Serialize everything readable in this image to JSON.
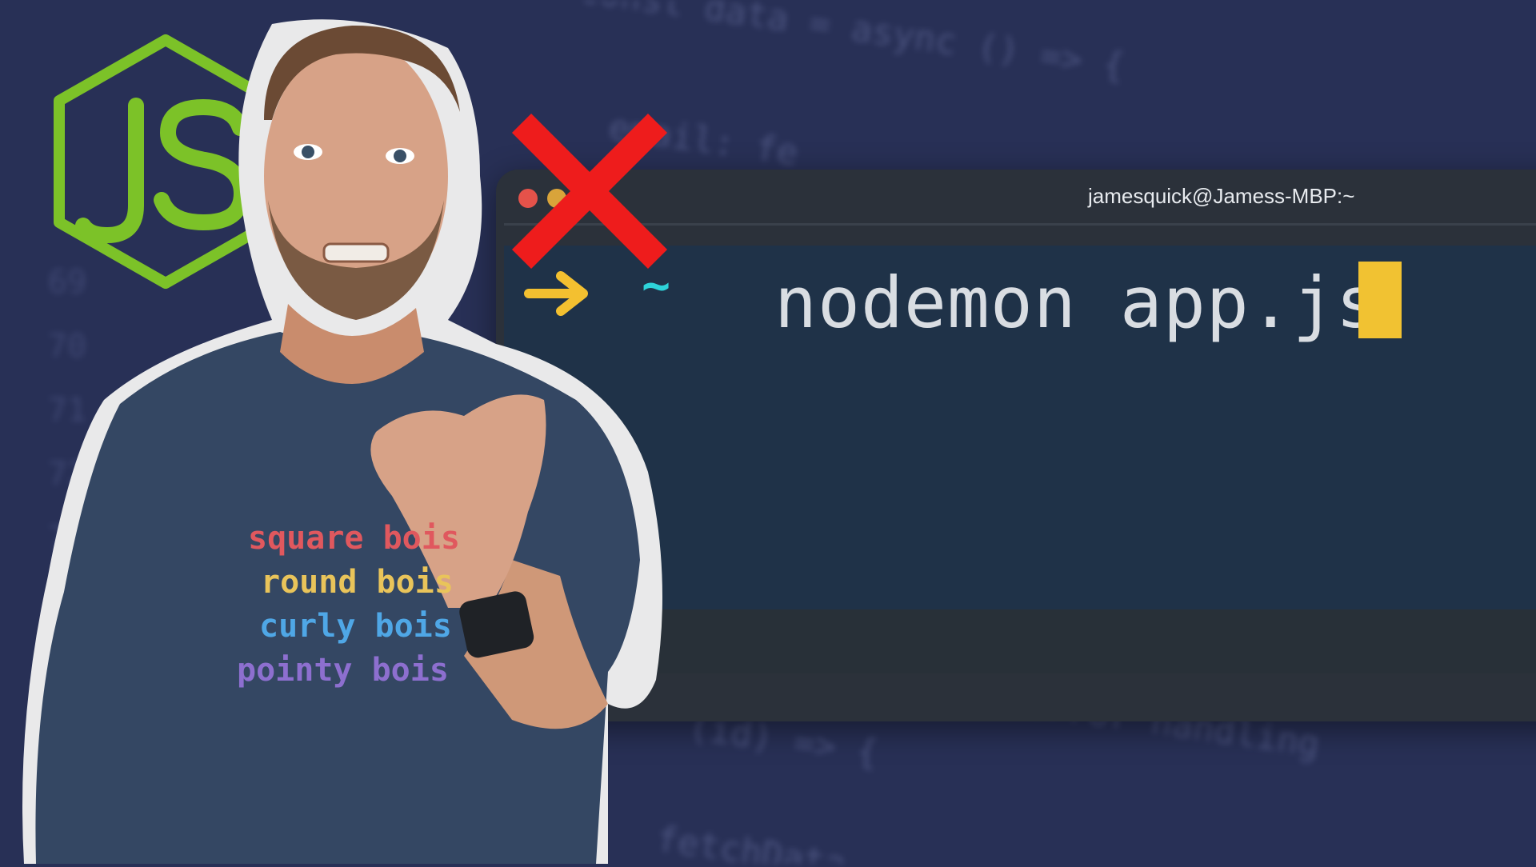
{
  "terminal": {
    "title": "jamesquick@Jamess-MBP:~",
    "prompt_symbol": "~",
    "command": "nodemon app.js"
  },
  "shirt": {
    "lines": [
      "square bois",
      "round bois",
      "curly bois",
      "pointy bois"
    ]
  },
  "colors": {
    "background": "#283056",
    "terminal_body": "#1f3248",
    "node_green": "#7cc228",
    "x_red": "#ee1c1c",
    "cursor_yellow": "#f1c232",
    "prompt_arrow": "#f3c030",
    "prompt_tilde": "#2ed3d9",
    "shirt_line_colors": [
      "#e0585e",
      "#e9c45a",
      "#4fa7e6",
      "#8d6fcf"
    ]
  },
  "icons": {
    "logo": "nodejs-js-logo",
    "prompt": "arrow-right-icon",
    "overlay": "red-x-icon"
  }
}
